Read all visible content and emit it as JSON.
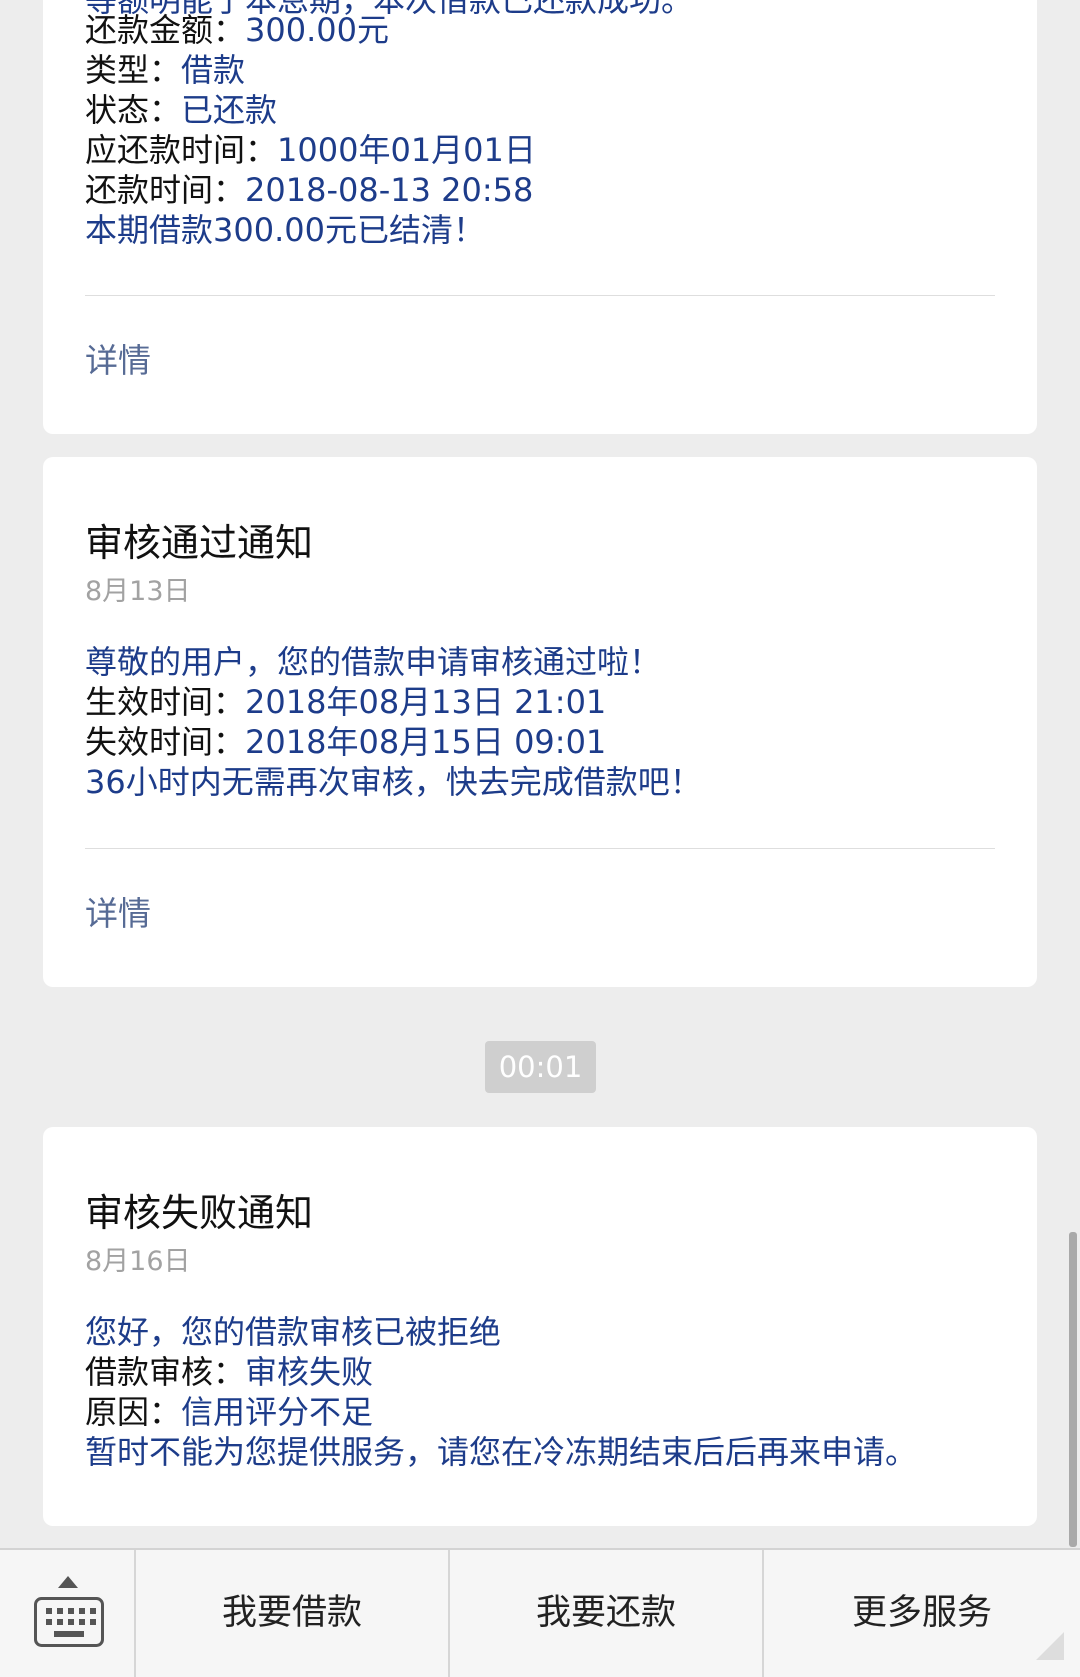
{
  "cards": [
    {
      "partial_top": "等额明能了本息期，本次借款已还款成功。",
      "lines": [
        {
          "label": "还款金额：",
          "value": "300.00元"
        },
        {
          "label": "类型：",
          "value": "借款"
        },
        {
          "label": "状态：",
          "value": "已还款"
        },
        {
          "label": "应还款时间：",
          "value": "1000年01月01日"
        },
        {
          "label": "还款时间：",
          "value": "2018-08-13 20:58"
        }
      ],
      "footer_note": "本期借款300.00元已结清！",
      "detail_label": "详情"
    },
    {
      "title": "审核通过通知",
      "date": "8月13日",
      "intro": "尊敬的用户，您的借款申请审核通过啦！",
      "lines": [
        {
          "label": "生效时间：",
          "value": "2018年08月13日 21:01"
        },
        {
          "label": "失效时间：",
          "value": "2018年08月15日 09:01"
        }
      ],
      "footer_note": "36小时内无需再次审核，快去完成借款吧！",
      "detail_label": "详情"
    },
    {
      "title": "审核失败通知",
      "date": "8月16日",
      "intro": "您好，您的借款审核已被拒绝",
      "lines": [
        {
          "label": "借款审核：",
          "value": "审核失败"
        },
        {
          "label": "原因：",
          "value": "信用评分不足"
        }
      ],
      "footer_note": "暂时不能为您提供服务，请您在冷冻期结束后后再来申请。"
    }
  ],
  "timestamp_badge": "00:01",
  "bottom_menu": {
    "keyboard_icon": "keyboard-icon",
    "items": [
      "我要借款",
      "我要还款",
      "更多服务"
    ]
  },
  "colors": {
    "background": "#ededed",
    "value_text": "#1d3c8a",
    "link_text": "#576b95",
    "date_text": "#a2a2a2"
  }
}
